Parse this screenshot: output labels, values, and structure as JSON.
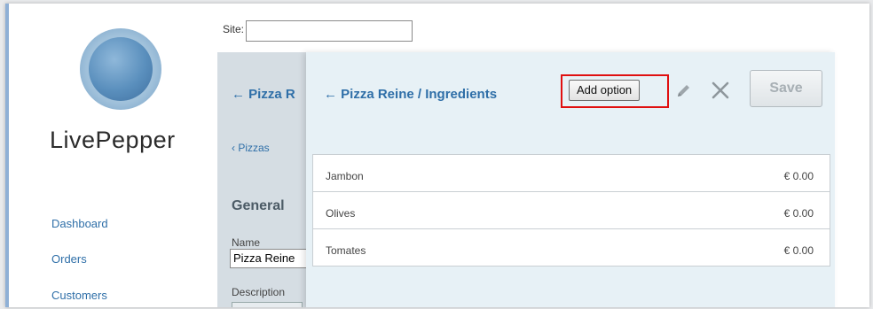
{
  "sidebar": {
    "logo_text": "LivePepper",
    "nav": [
      {
        "label": "Dashboard"
      },
      {
        "label": "Orders"
      },
      {
        "label": "Customers"
      }
    ]
  },
  "site": {
    "label": "Site:",
    "value": ""
  },
  "under_panel": {
    "back_title": "← Pizza R",
    "breadcrumb": "‹ Pizzas",
    "section_title": "General",
    "name_label": "Name",
    "name_value": "Pizza Reine",
    "description_label": "Description"
  },
  "overlay": {
    "title": "← Pizza Reine / Ingredients",
    "add_option_label": "Add option",
    "save_label": "Save",
    "edit_icon": "pencil-icon",
    "close_icon": "close-icon",
    "highlight_color": "#e01010",
    "ingredients": [
      {
        "name": "Jambon",
        "price": "€ 0.00"
      },
      {
        "name": "Olives",
        "price": "€ 0.00"
      },
      {
        "name": "Tomates",
        "price": "€ 0.00"
      }
    ]
  }
}
